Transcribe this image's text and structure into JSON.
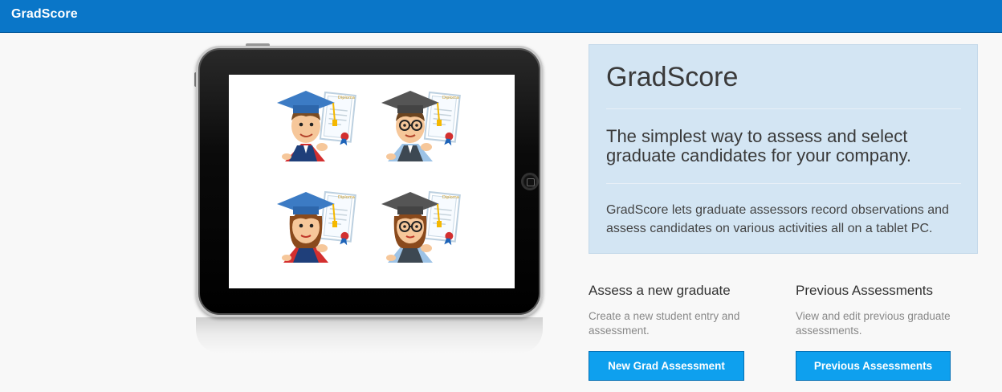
{
  "navbar": {
    "brand": "GradScore"
  },
  "hero": {
    "title": "GradScore",
    "tagline": "The simplest way to assess and select graduate candidates for your company.",
    "description": "GradScore lets graduate assessors record observations and assess candidates on various activities all on a tablet PC."
  },
  "illustration": {
    "certificate_text": "Diploma",
    "colors": {
      "cap_male": "#3c7bc4",
      "cap_female": "#3c7bc4",
      "cap_dark": "#555555",
      "gown_red": "#d32f2f",
      "tassel": "#f5b800"
    }
  },
  "cards": [
    {
      "title": "Assess a new graduate",
      "description": "Create a new student entry and assessment.",
      "button_label": "New Grad Assessment"
    },
    {
      "title": "Previous Assessments",
      "description": "View and edit previous graduate assessments.",
      "button_label": "Previous Assessments"
    }
  ],
  "colors": {
    "navbar": "#0a76c8",
    "button": "#0ea0ee",
    "hero_bg": "#d3e5f3"
  }
}
